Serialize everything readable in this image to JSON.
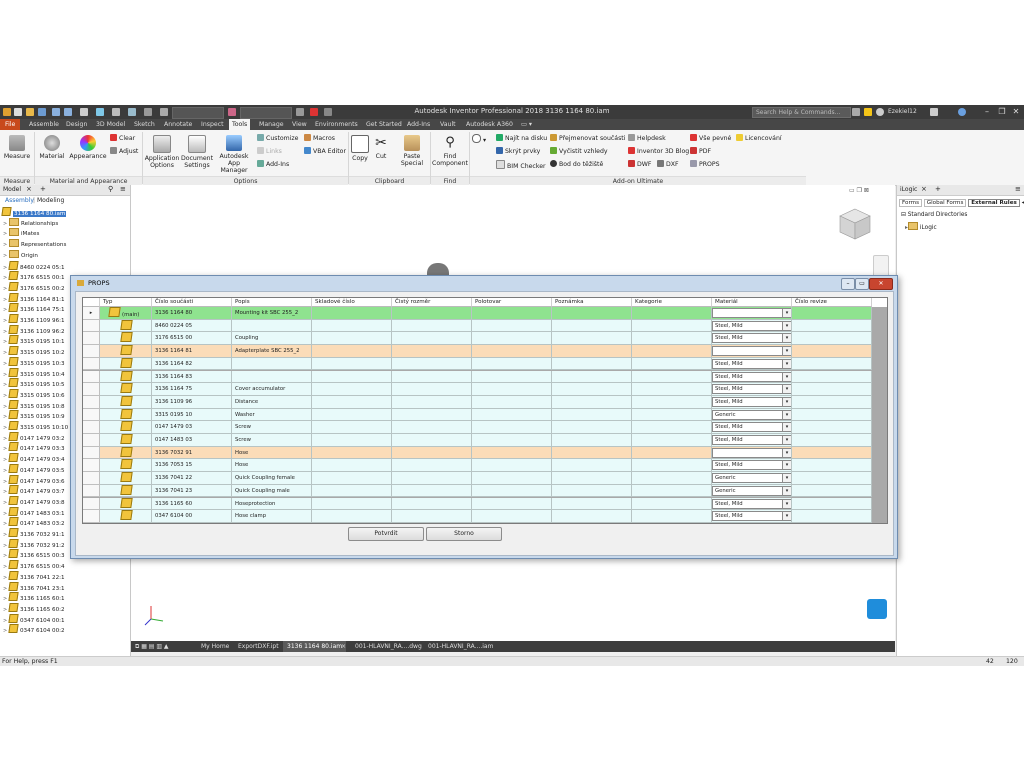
{
  "titlebar": {
    "title": "Autodesk Inventor Professional 2018   3136 1164 80.iam",
    "search_placeholder": "Search Help & Commands...",
    "user": "Ezekiel12"
  },
  "tabs": [
    "File",
    "Assemble",
    "Design",
    "3D Model",
    "Sketch",
    "Annotate",
    "Inspect",
    "Tools",
    "Manage",
    "View",
    "Environments",
    "Get Started",
    "Add-Ins",
    "Vault",
    "Autodesk A360"
  ],
  "active_tab": "Tools",
  "ribbon": {
    "measure": "Measure",
    "material": "Material",
    "appearance": "Appearance",
    "clear": "Clear",
    "adjust": "Adjust",
    "application_options": "Application Options",
    "document_settings": "Document Settings",
    "app_manager": "Autodesk App Manager",
    "customize": "Customize",
    "macros": "Macros",
    "links": "Links",
    "vba_editor": "VBA Editor",
    "addins": "Add-Ins",
    "copy": "Copy",
    "cut": "Cut",
    "paste_special": "Paste Special",
    "find_component": "Find Component",
    "najit": "Najít na disku",
    "skryt": "Skrýt prvky",
    "bim": "BIM Checker",
    "prejmenovat": "Přejmenovat součásti",
    "vycistit": "Vyčistit vzhledy",
    "bod": "Bod do těžiště",
    "helpdesk": "Helpdesk",
    "blog": "Inventor 3D Blog",
    "dwf": "DWF",
    "dxf": "DXF",
    "vse_pevne": "Vše pevné",
    "pdf": "PDF",
    "props": "PROPS",
    "licencovani": "Licencování",
    "groups": {
      "measure": "Measure",
      "material": "Material and Appearance",
      "options": "Options",
      "clipboard": "Clipboard",
      "find": "Find",
      "addon": "Add-on Ultimate"
    }
  },
  "left_panel": {
    "title": "Model",
    "tab_assembly": "Assembly",
    "tab_modeling": "Modeling",
    "root": "3136 1164 80.iam",
    "folders": [
      "Relationships",
      "iMates",
      "Representations",
      "Origin"
    ],
    "items": [
      "8460 0224 05:1",
      "3176 6515 00:1",
      "3176 6515 00:2",
      "3136 1164 81:1",
      "3136 1164 75:1",
      "3136 1109 96:1",
      "3136 1109 96:2",
      "3315 0195 10:1",
      "3315 0195 10:2",
      "3315 0195 10:3",
      "3315 0195 10:4",
      "3315 0195 10:5",
      "3315 0195 10:6",
      "3315 0195 10:8",
      "3315 0195 10:9",
      "3315 0195 10:10",
      "0147 1479 03:2",
      "0147 1479 03:3",
      "0147 1479 03:4",
      "0147 1479 03:5",
      "0147 1479 03:6",
      "0147 1479 03:7",
      "0147 1479 03:8",
      "0147 1483 03:1",
      "0147 1483 03:2",
      "3136 7032 91:1",
      "3136 7032 91:2",
      "3136 6515 00:3",
      "3176 6515 00:4",
      "3136 7041 22:1",
      "3136 7041 23:1",
      "3136 1165 60:1",
      "3136 1165 60:2",
      "0347 6104 00:1",
      "0347 6104 00:2"
    ]
  },
  "right_panel": {
    "title": "iLogic",
    "tabs": [
      "Forms",
      "Global Forms",
      "External Rules"
    ],
    "tree_root": "Standard Directories",
    "tree_child": "iLogic"
  },
  "bottom_tabs": [
    "My Home",
    "ExportDXF.ipt",
    "3136 1164 80.iam",
    "001-HLAVNI_RA....dwg",
    "001-HLAVNI_RA....iam"
  ],
  "statusbar": {
    "help": "For Help, press F1",
    "num1": "42",
    "num2": "120"
  },
  "dialog": {
    "title": "PROPS",
    "columns": [
      "Typ",
      "Číslo součásti",
      "Popis",
      "Skladové číslo",
      "Čistý rozměr",
      "Polotovar",
      "Poznámka",
      "Kategorie",
      "Materiál",
      "Číslo revize"
    ],
    "main_label": "(main)",
    "rows": [
      {
        "part": "3136 1164 80",
        "desc": "Mounting kit SBC 255_2",
        "mat": "",
        "style": "green"
      },
      {
        "part": "8460 0224 05",
        "desc": "",
        "mat": "Steel, Mild",
        "style": "plain"
      },
      {
        "part": "3176 6515 00",
        "desc": "Coupling",
        "mat": "Steel, Mild",
        "style": "plain"
      },
      {
        "part": "3136 1164 81",
        "desc": "Adapterplate SBC 255_2",
        "mat": "",
        "style": "orange"
      },
      {
        "part": "3136 1164 82",
        "desc": "",
        "mat": "Steel, Mild",
        "style": "plain"
      },
      {
        "part": "3136 1164 83",
        "desc": "",
        "mat": "Steel, Mild",
        "style": "plain"
      },
      {
        "part": "3136 1164 75",
        "desc": "Cover accumulator",
        "mat": "Steel, Mild",
        "style": "plain"
      },
      {
        "part": "3136 1109 96",
        "desc": "Distance",
        "mat": "Steel, Mild",
        "style": "plain"
      },
      {
        "part": "3315 0195 10",
        "desc": "Washer",
        "mat": "Generic",
        "style": "plain"
      },
      {
        "part": "0147 1479 03",
        "desc": "Screw",
        "mat": "Steel, Mild",
        "style": "plain"
      },
      {
        "part": "0147 1483 03",
        "desc": "Screw",
        "mat": "Steel, Mild",
        "style": "plain"
      },
      {
        "part": "3136 7032 91",
        "desc": "Hose",
        "mat": "",
        "style": "orange"
      },
      {
        "part": "3136 7053 15",
        "desc": "Hose",
        "mat": "Steel, Mild",
        "style": "plain"
      },
      {
        "part": "3136 7041 22",
        "desc": "Quick Coupling female",
        "mat": "Generic",
        "style": "plain"
      },
      {
        "part": "3136 7041 23",
        "desc": "Quick Coupling male",
        "mat": "Generic",
        "style": "plain"
      },
      {
        "part": "3136 1165 60",
        "desc": "Hoseprotection",
        "mat": "Steel, Mild",
        "style": "plain"
      },
      {
        "part": "0347 6104 00",
        "desc": "Hose clamp",
        "mat": "Steel, Mild",
        "style": "plain"
      }
    ],
    "confirm": "Potvrdit",
    "cancel": "Storno"
  },
  "colors": {
    "file_tab": "#c8491c",
    "row_green": "#8fe38f",
    "row_orange": "#fbdcb8",
    "row_plain": "#e8fafa"
  }
}
